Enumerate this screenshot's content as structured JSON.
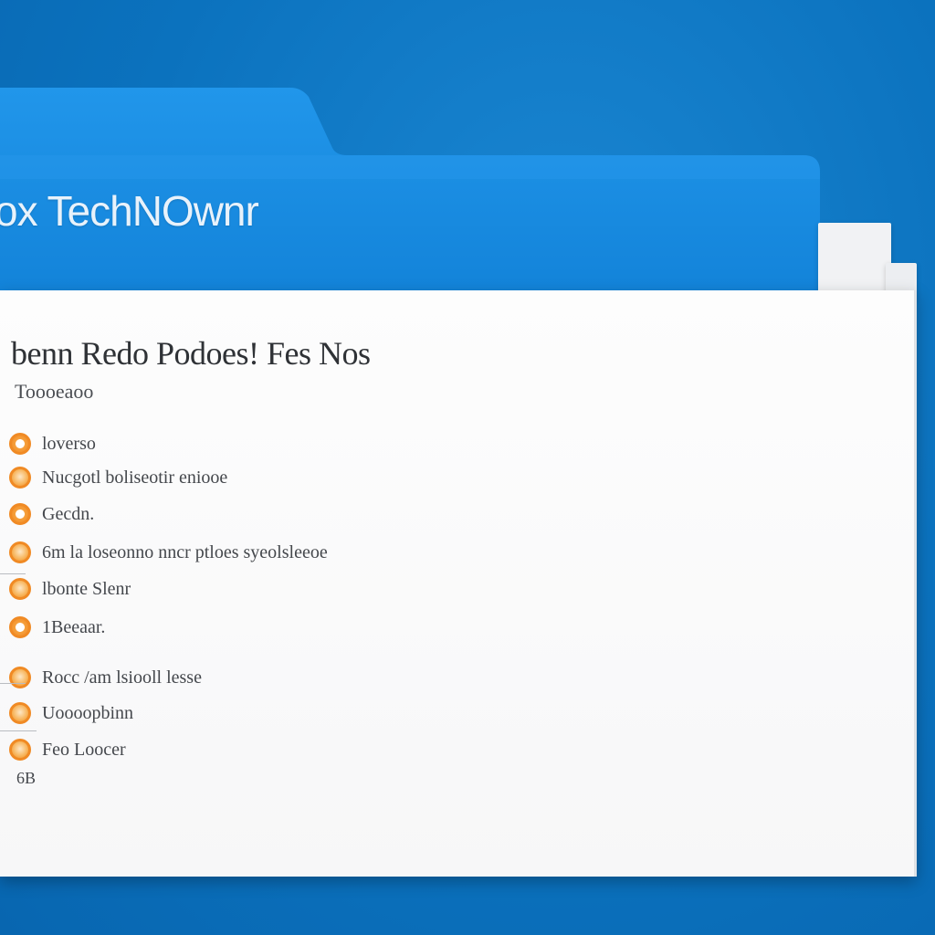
{
  "colors": {
    "background": "#0a74c2",
    "folder": "#1d8fe6",
    "folder_dark": "#157dd0",
    "sheet": "#fdfdfd",
    "bullet_accent": "#f08a24"
  },
  "folder": {
    "title": "ox TechNOwnr"
  },
  "document": {
    "title": "benn Redo Podoes! Fes Nos",
    "subtitle": "Toooeaoo",
    "items": [
      {
        "label": "loverso",
        "icon": "orange-circle-icon"
      },
      {
        "label": "Nucgotl boliseotir eniooe",
        "icon": "orange-circle-icon"
      },
      {
        "label": "Gecdn.",
        "icon": "orange-circle-icon"
      },
      {
        "label": "6m la loseonno nncr ptloes syeolsleeoe",
        "icon": "orange-circle-icon"
      },
      {
        "label": "lbonte Slenr",
        "icon": "orange-circle-icon"
      },
      {
        "label": "1Beeaar.",
        "icon": "orange-circle-icon"
      },
      {
        "label": "Rocc /am lsiooll lesse",
        "icon": "orange-circle-icon"
      },
      {
        "label": "Uoooopbinn",
        "icon": "orange-circle-icon"
      },
      {
        "label": "Feo Loocer",
        "icon": "orange-circle-icon"
      }
    ],
    "footer": "6B"
  }
}
